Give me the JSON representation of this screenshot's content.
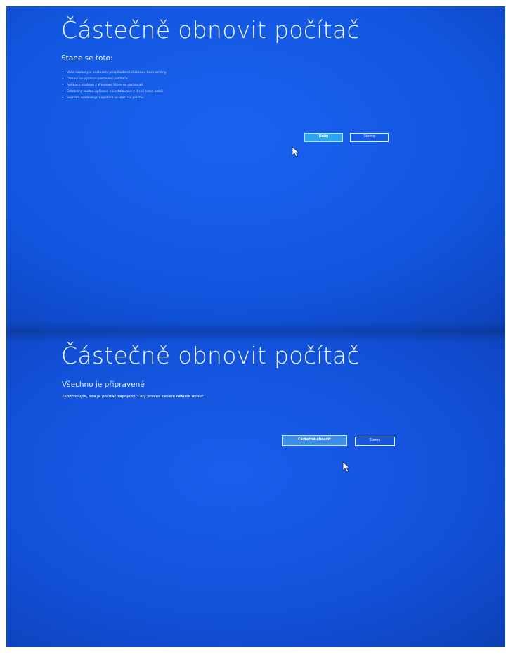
{
  "top_screen": {
    "title": "Částečně obnovit počítač",
    "subtitle": "Stane se toto:",
    "bullets": [
      "Vaše soubory a nastavení přizpůsobení zůstanou beze změny.",
      "Obnoví se výchozí nastavení počítače.",
      "Aplikace stažené z Windows Store se zachovají.",
      "Odebrány budou aplikace nainstalované z disků nebo webů.",
      "Seznam odebraných aplikací se uloží na plochu."
    ],
    "next_button": "Další",
    "cancel_button": "Storno"
  },
  "bottom_screen": {
    "title": "Částečně obnovit počítač",
    "subtitle": "Všechno je připravené",
    "body": "Zkontrolujte, zda je počítač zapojený. Celý proces zabere několik minut.",
    "refresh_button": "Částečně obnovit",
    "cancel_button": "Storno"
  },
  "colors": {
    "background_blue": "#1256e0",
    "primary_button": "#2aa6f2",
    "text": "#ffffff"
  },
  "icons": [
    "mouse-cursor-icon"
  ]
}
